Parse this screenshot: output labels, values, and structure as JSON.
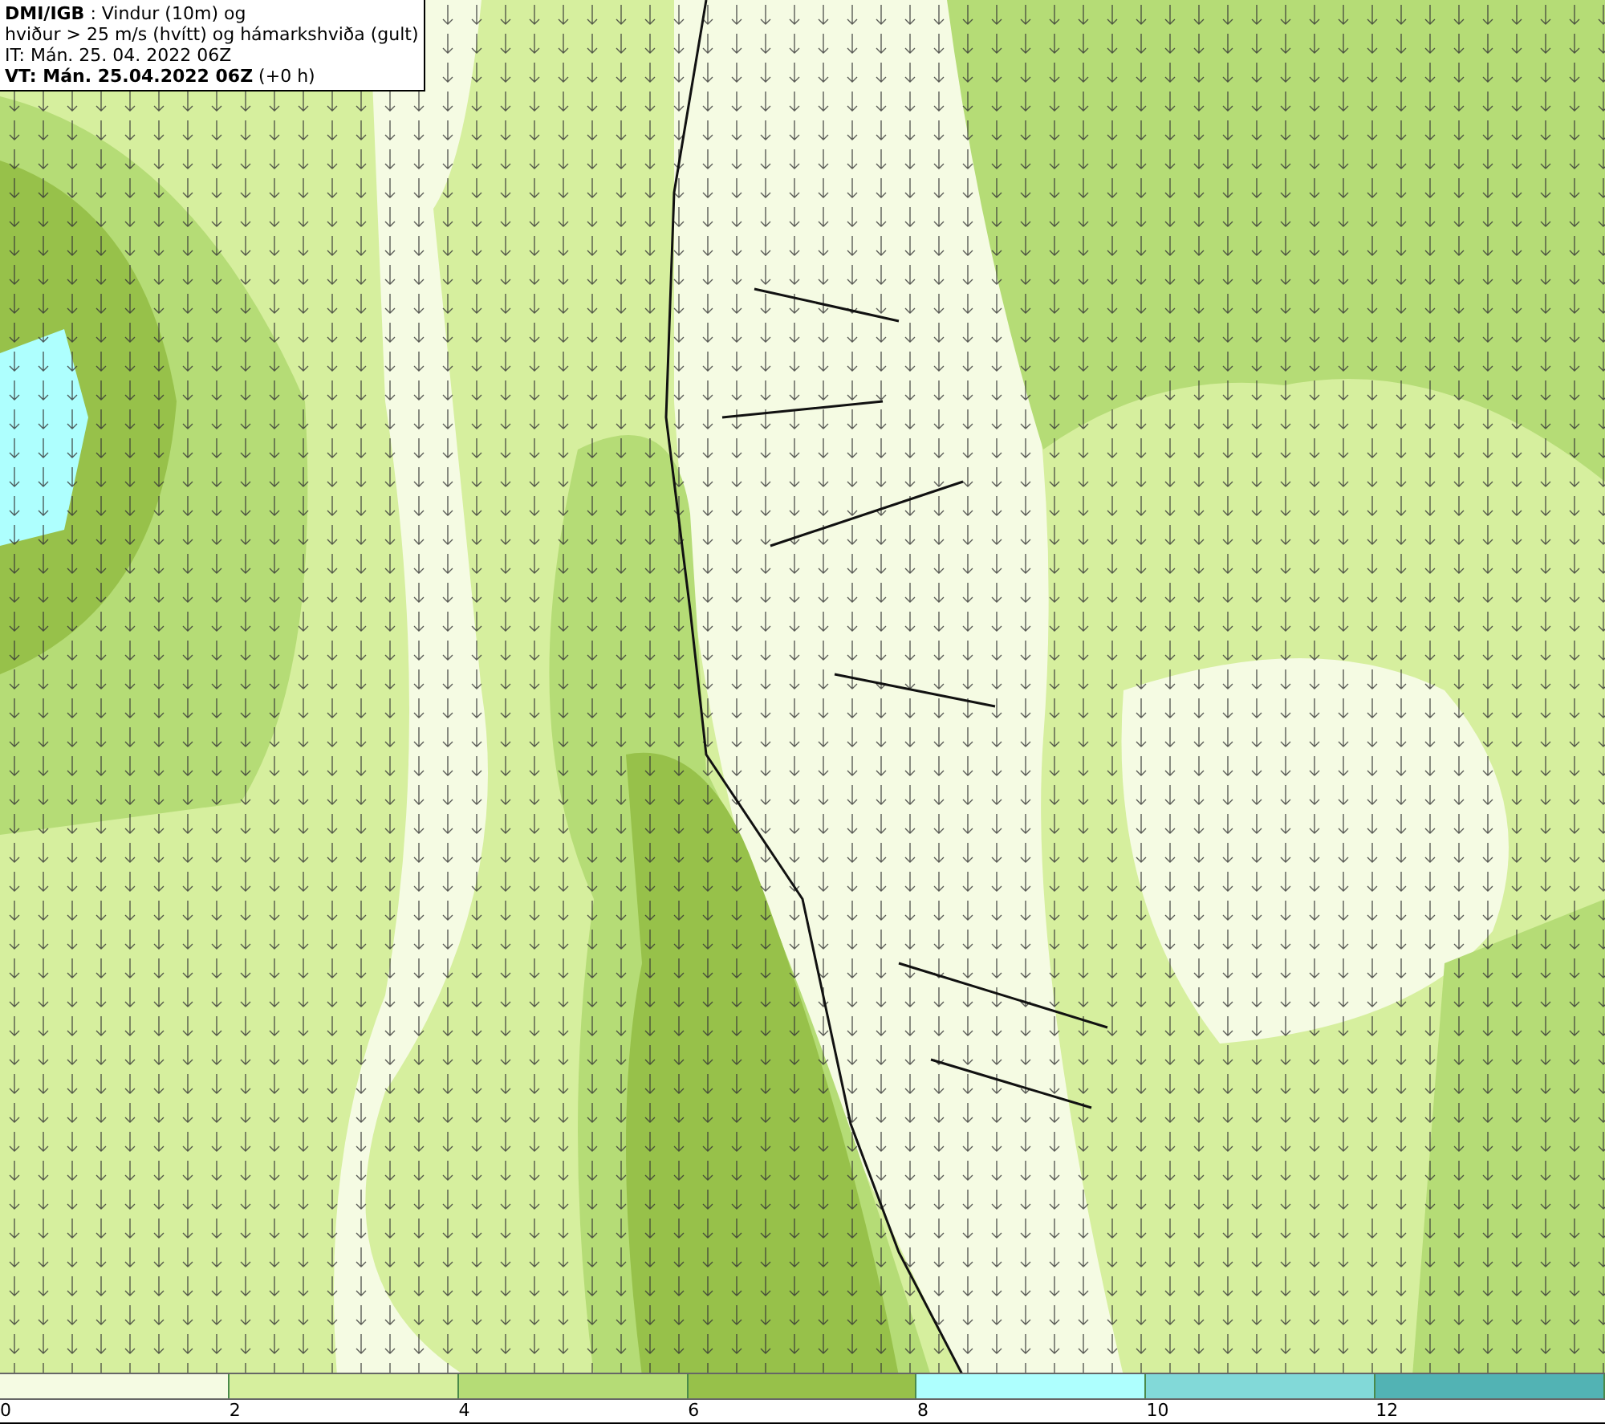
{
  "header": {
    "lines": [
      "**DMI/IGB** : Vindur (10m) og",
      "hviður > 25 m/s (hvítt) og hámarkshviða (gult)",
      "IT: Mán. 25. 04. 2022 06Z",
      "**VT: Mán. 25.04.2022 06Z** (+0 h)"
    ]
  },
  "legend": {
    "bins": [
      {
        "color": "#f5fbe3",
        "label": "0"
      },
      {
        "color": "#d6ef9e",
        "label": "2"
      },
      {
        "color": "#b5dc76",
        "label": "4"
      },
      {
        "color": "#97c14a",
        "label": "6"
      },
      {
        "color": "#aefffe",
        "label": "8"
      },
      {
        "color": "#82d9d8",
        "label": "10"
      },
      {
        "color": "#52b3b4",
        "label": "12"
      }
    ]
  }
}
